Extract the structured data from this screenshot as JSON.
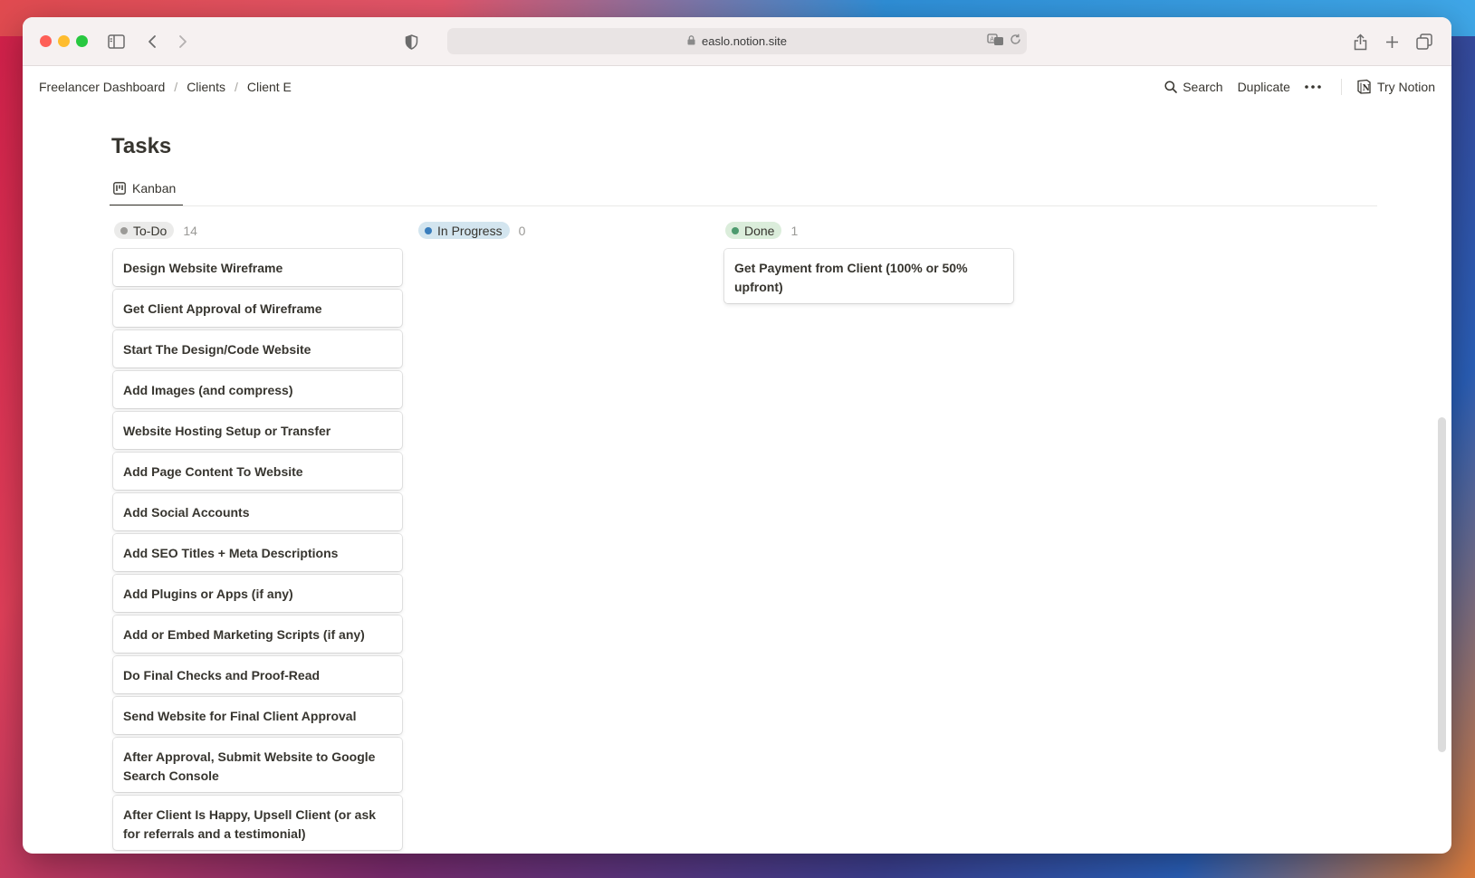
{
  "browser": {
    "url": "easlo.notion.site"
  },
  "breadcrumb": [
    "Freelancer Dashboard",
    "Clients",
    "Client E"
  ],
  "actions": {
    "search": "Search",
    "duplicate": "Duplicate",
    "try_notion": "Try Notion"
  },
  "page": {
    "title": "Tasks",
    "view_tab": "Kanban"
  },
  "board": {
    "columns": [
      {
        "name": "To-Do",
        "count": "14",
        "color": "#9b9a97",
        "bg": "#ebebea",
        "cards": [
          "Design Website Wireframe",
          "Get Client Approval of Wireframe",
          "Start The Design/Code Website",
          "Add Images (and compress)",
          "Website Hosting Setup or Transfer",
          "Add Page Content To Website",
          "Add Social Accounts",
          "Add SEO Titles + Meta Descriptions",
          "Add Plugins or Apps (if any)",
          "Add or Embed Marketing Scripts (if any)",
          "Do Final Checks and Proof-Read",
          "Send Website for Final Client Approval",
          "After Approval, Submit Website to Google Search Console",
          "After Client Is Happy, Upsell Client (or ask for referrals and a testimonial)"
        ]
      },
      {
        "name": "In Progress",
        "count": "0",
        "color": "#3a7ebd",
        "bg": "#d3e5ef",
        "cards": []
      },
      {
        "name": "Done",
        "count": "1",
        "color": "#4d9a6e",
        "bg": "#dbeddb",
        "cards": [
          "Get Payment from Client (100% or 50% upfront)"
        ]
      }
    ]
  },
  "icons": [
    "sidebar-icon",
    "back-icon",
    "forward-icon",
    "shield-icon",
    "lock-icon",
    "translate-icon",
    "reload-icon",
    "share-icon",
    "new-tab-icon",
    "tabs-overview-icon",
    "search-icon",
    "more-icon",
    "notion-logo-icon",
    "board-view-icon"
  ]
}
